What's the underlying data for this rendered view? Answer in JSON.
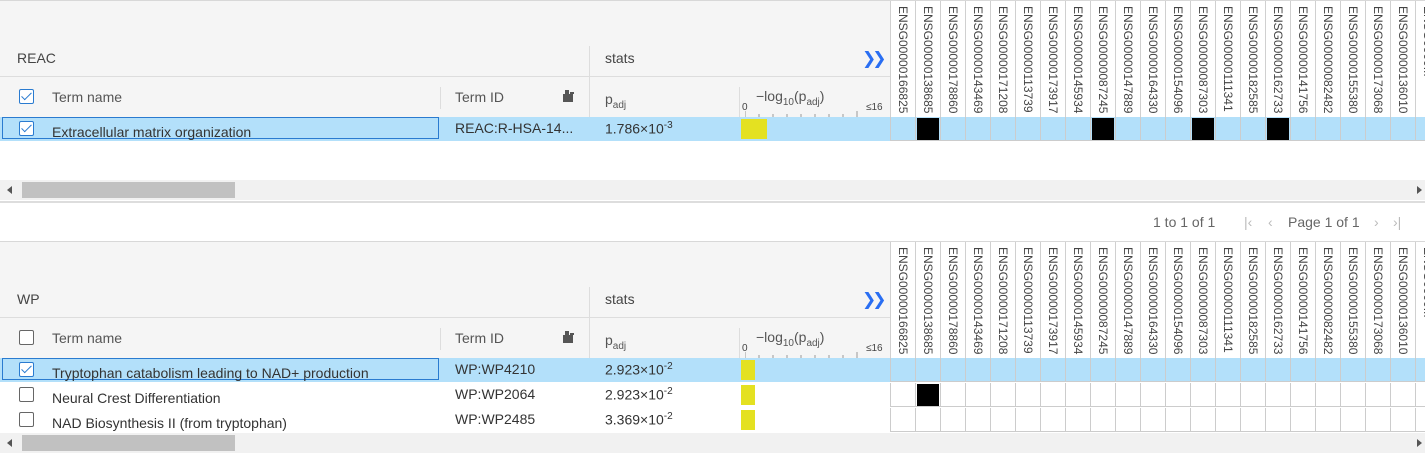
{
  "genes": [
    "ENSG00000166825",
    "ENSG00000138685",
    "ENSG00000178860",
    "ENSG00000143469",
    "ENSG00000171208",
    "ENSG00000113739",
    "ENSG00000173917",
    "ENSG00000145934",
    "ENSG00000087245",
    "ENSG00000147889",
    "ENSG00000164330",
    "ENSG00000154096",
    "ENSG00000087303",
    "ENSG00000111341",
    "ENSG00000182585",
    "ENSG00000162733",
    "ENSG00000141756",
    "ENSG00000082482",
    "ENSG00000155380",
    "ENSG00000173068",
    "ENSG00000136010",
    "ENSG0000..."
  ],
  "columns": {
    "term_name": "Term name",
    "term_id": "Term ID",
    "stats": "stats",
    "padj": "p",
    "padj_sub": "adj",
    "log_label_a": "−log",
    "log_label_sub": "10",
    "log_label_b": "(p",
    "log_label_sub2": "adj",
    "log_label_c": ")",
    "scale_min": "0",
    "scale_max": "≤16",
    "expand": "❯❯"
  },
  "reac": {
    "group": "REAC",
    "header_checked": true,
    "rows": [
      {
        "checked": true,
        "selected": true,
        "name": "Extracellular matrix organization",
        "id": "REAC:R-HSA-14...",
        "padj_base": "1.786×10",
        "padj_exp": "-3",
        "bar_frac": 0.175,
        "hits": [
          1,
          8,
          12,
          15
        ]
      }
    ]
  },
  "pager": {
    "range": "1 to 1 of 1",
    "page": "Page 1 of 1"
  },
  "wp": {
    "group": "WP",
    "header_checked": false,
    "rows": [
      {
        "checked": true,
        "selected": true,
        "name": "Tryptophan catabolism leading to NAD+ production",
        "id": "WP:WP4210",
        "padj_base": "2.923×10",
        "padj_exp": "-2",
        "bar_frac": 0.095,
        "hits": []
      },
      {
        "checked": false,
        "selected": false,
        "name": "Neural Crest Differentiation",
        "id": "WP:WP2064",
        "padj_base": "2.923×10",
        "padj_exp": "-2",
        "bar_frac": 0.095,
        "hits": [
          1
        ]
      },
      {
        "checked": false,
        "selected": false,
        "name": "NAD Biosynthesis II (from tryptophan)",
        "id": "WP:WP2485",
        "padj_base": "3.369×10",
        "padj_exp": "-2",
        "bar_frac": 0.095,
        "hits": []
      }
    ]
  }
}
